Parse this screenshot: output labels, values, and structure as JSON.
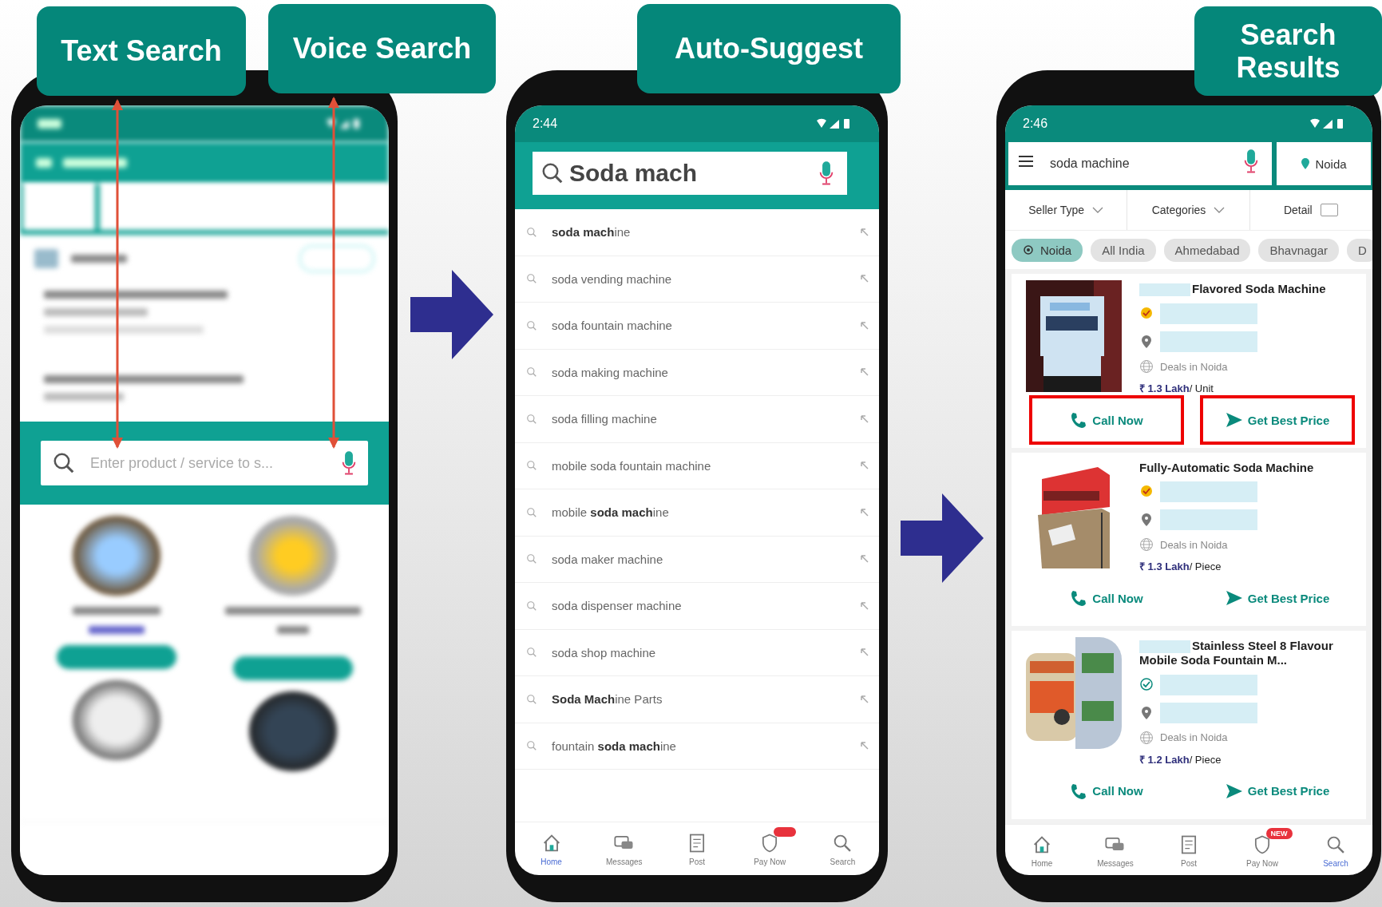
{
  "labels": [
    {
      "text": "Text Search"
    },
    {
      "text": "Voice Search"
    },
    {
      "text": "Auto-Suggest"
    },
    {
      "text": "Search Results"
    }
  ],
  "home_screen": {
    "search": {
      "placeholder": "Enter product / service to s..."
    }
  },
  "suggest_screen": {
    "status_time": "2:44",
    "search": {
      "value": "Soda mach"
    },
    "suggestions": [
      {
        "text": "**soda mach**ine"
      },
      {
        "text": "soda vending machine"
      },
      {
        "text": "soda fountain machine"
      },
      {
        "text": "soda making machine"
      },
      {
        "text": "soda filling machine"
      },
      {
        "text": "mobile soda fountain machine"
      },
      {
        "text": "mobile **soda mach**ine"
      },
      {
        "text": "soda maker machine"
      },
      {
        "text": "soda dispenser machine"
      },
      {
        "text": "soda shop machine"
      },
      {
        "text": "**Soda Mach**ine Parts"
      },
      {
        "text": "fountain **soda mach**ine"
      }
    ],
    "nav": [
      {
        "label": "Home",
        "selected": true
      },
      {
        "label": "Messages",
        "selected": false
      },
      {
        "label": "Post",
        "selected": false
      },
      {
        "label": "Pay Now",
        "selected": false
      },
      {
        "label": "Search",
        "selected": false
      }
    ]
  },
  "results_screen": {
    "status_time": "2:46",
    "search": {
      "value": "soda machine"
    },
    "location": "Noida",
    "filters": [
      {
        "label": "Seller Type",
        "kind": "dropdown"
      },
      {
        "label": "Categories",
        "kind": "dropdown"
      },
      {
        "label": "Detail",
        "kind": "toggle"
      }
    ],
    "chips": [
      {
        "label": "Noida",
        "selected": true
      },
      {
        "label": "All India",
        "selected": false
      },
      {
        "label": "Ahmedabad",
        "selected": false
      },
      {
        "label": "Bhavnagar",
        "selected": false
      },
      {
        "label": "D",
        "selected": false
      }
    ],
    "listings": [
      {
        "title": "Flavored Soda Machine",
        "redacted_title": true,
        "kind": "gold",
        "deals": "Deals in Noida",
        "price": "₹ 1.3 Lakh",
        "unit": "/ Unit",
        "call": "Call Now",
        "quote": "Get Best Price",
        "highlighted": true
      },
      {
        "title": "Fully-Automatic Soda Machine",
        "redacted_title": false,
        "kind": "gold",
        "deals": "Deals in Noida",
        "price": "₹ 1.3 Lakh",
        "unit": "/ Piece",
        "call": "Call Now",
        "quote": "Get Best Price",
        "highlighted": false
      },
      {
        "title": "Stainless Steel 8 Flavour Mobile Soda Fountain M...",
        "redacted_title": true,
        "kind": "trust",
        "deals": "Deals in Noida",
        "price": "₹ 1.2 Lakh",
        "unit": "/ Piece",
        "call": "Call Now",
        "quote": "Get Best Price",
        "highlighted": false
      }
    ],
    "nav": [
      {
        "label": "Home",
        "selected": false
      },
      {
        "label": "Messages",
        "selected": false
      },
      {
        "label": "Post",
        "selected": false
      },
      {
        "label": "Pay Now",
        "selected": false,
        "badge": "NEW"
      },
      {
        "label": "Search",
        "selected": true
      }
    ]
  }
}
